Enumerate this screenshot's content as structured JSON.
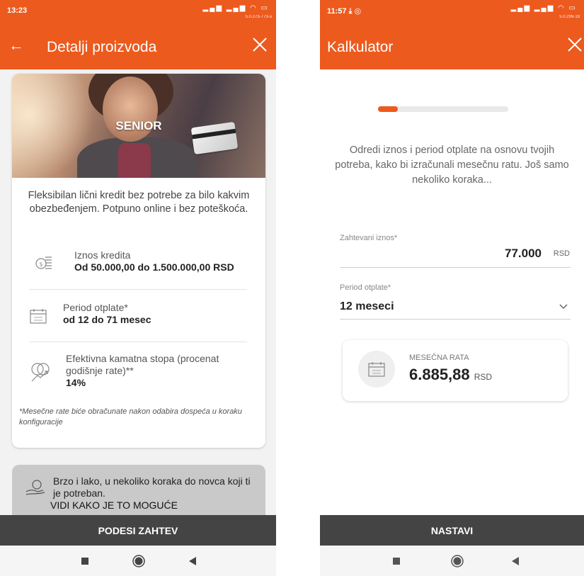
{
  "colors": {
    "brand": "#ec5a1e",
    "bottom_button": "#444444",
    "info_box": "#c9c9c9"
  },
  "left": {
    "status": {
      "time": "13:23",
      "version": "5.0.273-773-u"
    },
    "appbar": {
      "title": "Detalji proizvoda",
      "back_icon": "arrow-left-icon",
      "close_icon": "close-icon"
    },
    "card": {
      "hero_label": "SENIOR",
      "description": "Fleksibilan lični kredit bez potrebe za bilo kakvim obezbeđenjem. Potpuno online i bez poteškoća.",
      "features": [
        {
          "icon": "coins-icon",
          "label": "Iznos kredita",
          "value": "Od 50.000,00 do 1.500.000,00 RSD"
        },
        {
          "icon": "calendar-icon",
          "label": "Period otplate*",
          "value": "od 12 do 71 mesec"
        },
        {
          "icon": "percent-growth-icon",
          "label": "Efektivna kamatna stopa (procenat godišnje rate)**",
          "value": "14%"
        }
      ],
      "note": "*Mesečne rate biće obračunate nakon odabira dospeća u koraku konfiguracije"
    },
    "info": {
      "icon": "hand-money-icon",
      "text": "Brzo i lako, u nekoliko koraka do novca koji ti je potreban.",
      "link": "VIDI KAKO JE TO MOGUĆE"
    },
    "button": "PODESI ZAHTEV"
  },
  "right": {
    "status": {
      "time": "11:57",
      "version": "5.0.299-19"
    },
    "appbar": {
      "title": "Kalkulator",
      "close_icon": "close-icon"
    },
    "progress": 0.15,
    "intro": "Odredi iznos i period otplate na osnovu tvojih potreba, kako bi izračunali mesečnu ratu. Još samo nekoliko koraka...",
    "amount": {
      "label": "Zahtevani iznos*",
      "value": "77.000",
      "currency": "RSD"
    },
    "period": {
      "label": "Period otplate*",
      "value": "12 meseci"
    },
    "rate": {
      "label": "MESEČNA RATA",
      "value": "6.885,88",
      "currency": "RSD"
    },
    "button": "NASTAVI"
  },
  "navbar": {
    "icons": [
      "square-icon",
      "circle-icon",
      "triangle-back-icon"
    ]
  }
}
